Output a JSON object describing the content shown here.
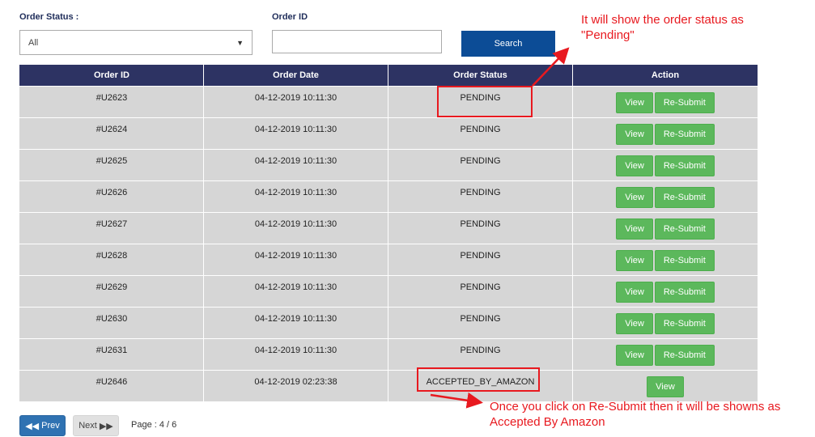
{
  "filters": {
    "status_label": "Order Status :",
    "status_value": "All",
    "orderid_label": "Order ID",
    "orderid_value": "",
    "search_label": "Search"
  },
  "table": {
    "headers": [
      "Order ID",
      "Order Date",
      "Order Status",
      "Action"
    ],
    "rows": [
      {
        "id": "#U2623",
        "date": "04-12-2019 10:11:30",
        "status": "PENDING",
        "actions": [
          "View",
          "Re-Submit"
        ]
      },
      {
        "id": "#U2624",
        "date": "04-12-2019 10:11:30",
        "status": "PENDING",
        "actions": [
          "View",
          "Re-Submit"
        ]
      },
      {
        "id": "#U2625",
        "date": "04-12-2019 10:11:30",
        "status": "PENDING",
        "actions": [
          "View",
          "Re-Submit"
        ]
      },
      {
        "id": "#U2626",
        "date": "04-12-2019 10:11:30",
        "status": "PENDING",
        "actions": [
          "View",
          "Re-Submit"
        ]
      },
      {
        "id": "#U2627",
        "date": "04-12-2019 10:11:30",
        "status": "PENDING",
        "actions": [
          "View",
          "Re-Submit"
        ]
      },
      {
        "id": "#U2628",
        "date": "04-12-2019 10:11:30",
        "status": "PENDING",
        "actions": [
          "View",
          "Re-Submit"
        ]
      },
      {
        "id": "#U2629",
        "date": "04-12-2019 10:11:30",
        "status": "PENDING",
        "actions": [
          "View",
          "Re-Submit"
        ]
      },
      {
        "id": "#U2630",
        "date": "04-12-2019 10:11:30",
        "status": "PENDING",
        "actions": [
          "View",
          "Re-Submit"
        ]
      },
      {
        "id": "#U2631",
        "date": "04-12-2019 10:11:30",
        "status": "PENDING",
        "actions": [
          "View",
          "Re-Submit"
        ]
      },
      {
        "id": "#U2646",
        "date": "04-12-2019 02:23:38",
        "status": "ACCEPTED_BY_AMAZON",
        "actions": [
          "View"
        ]
      }
    ]
  },
  "pagination": {
    "prev_label": "Prev",
    "next_label": "Next",
    "page_info": "Page : 4 / 6"
  },
  "annotations": {
    "top_line1": "It will show the order status as",
    "top_line2": "\"Pending\"",
    "bottom_line1": "Once you click on Re-Submit then it will be  showns as",
    "bottom_line2": "Accepted By Amazon"
  },
  "icons": {
    "select_caret": "caret-down-icon",
    "prev": "double-chevron-left-icon",
    "next": "double-chevron-right-icon"
  },
  "colors": {
    "header_bg": "#2d3363",
    "search_button": "#0c4c96",
    "action_button": "#5cb85c",
    "annotation": "#e8191f"
  }
}
